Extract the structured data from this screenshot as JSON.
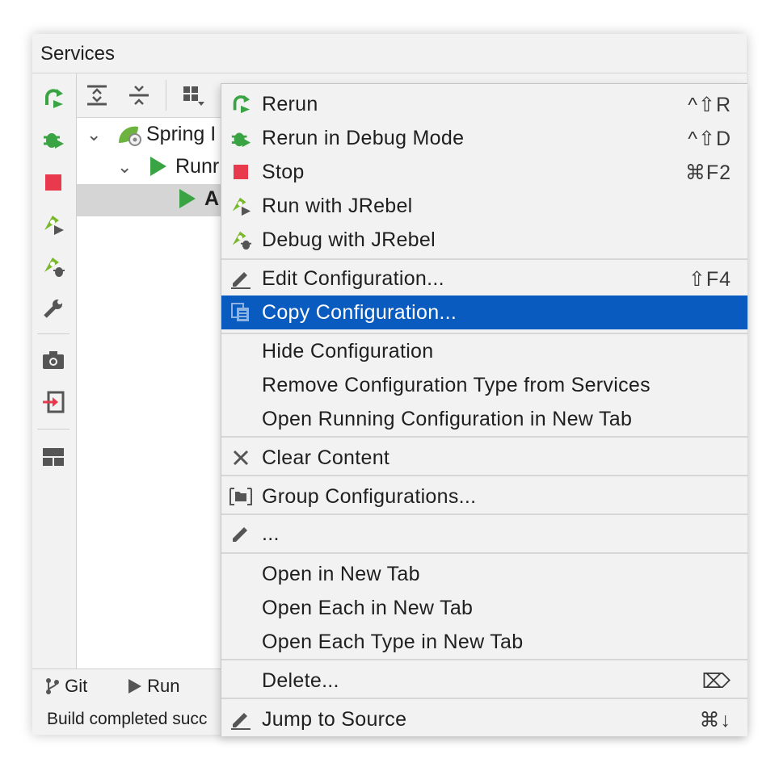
{
  "window": {
    "title": "Services"
  },
  "tree": {
    "rows": [
      {
        "label": "Spring I",
        "chevron": "⌄"
      },
      {
        "label": "Runr",
        "chevron": "⌄"
      },
      {
        "label": "A"
      }
    ]
  },
  "bottom_tabs": [
    {
      "label": "Git"
    },
    {
      "label": "Run"
    }
  ],
  "status": {
    "text": "Build completed succ"
  },
  "menu": {
    "items": [
      {
        "label": "Rerun",
        "shortcut": "^⇧R",
        "icon": "rerun-icon"
      },
      {
        "label": "Rerun in Debug Mode",
        "shortcut": "^⇧D",
        "icon": "rerun-debug-icon"
      },
      {
        "label": "Stop",
        "shortcut": "⌘F2",
        "icon": "stop-icon"
      },
      {
        "label": "Run with JRebel",
        "shortcut": "",
        "icon": "jrebel-run-icon"
      },
      {
        "label": "Debug with JRebel",
        "shortcut": "",
        "icon": "jrebel-debug-icon"
      },
      {
        "label": "Edit Configuration...",
        "shortcut": "⇧F4",
        "icon": "edit-icon"
      },
      {
        "label": "Copy Configuration...",
        "shortcut": "",
        "icon": "copy-icon",
        "active": true
      },
      {
        "label": "Hide Configuration",
        "shortcut": ""
      },
      {
        "label": "Remove Configuration Type from Services",
        "shortcut": ""
      },
      {
        "label": "Open Running Configuration in New Tab",
        "shortcut": ""
      },
      {
        "label": "Clear Content",
        "shortcut": "",
        "icon": "close-icon"
      },
      {
        "label": "Group Configurations...",
        "shortcut": "",
        "icon": "folder-icon"
      },
      {
        "label": "...",
        "shortcut": "",
        "icon": "pencil-icon"
      },
      {
        "label": "Open in New Tab",
        "shortcut": ""
      },
      {
        "label": "Open Each in New Tab",
        "shortcut": ""
      },
      {
        "label": "Open Each Type in New Tab",
        "shortcut": ""
      },
      {
        "label": "Delete...",
        "shortcut": "⌦",
        "icon": ""
      },
      {
        "label": "Jump to Source",
        "shortcut": "⌘↓",
        "icon": "edit-icon"
      }
    ]
  },
  "colors": {
    "accent": "#0a5bbf",
    "run_green": "#3aa343",
    "stop_red": "#e8394d",
    "jrebel_green": "#78b82a"
  }
}
